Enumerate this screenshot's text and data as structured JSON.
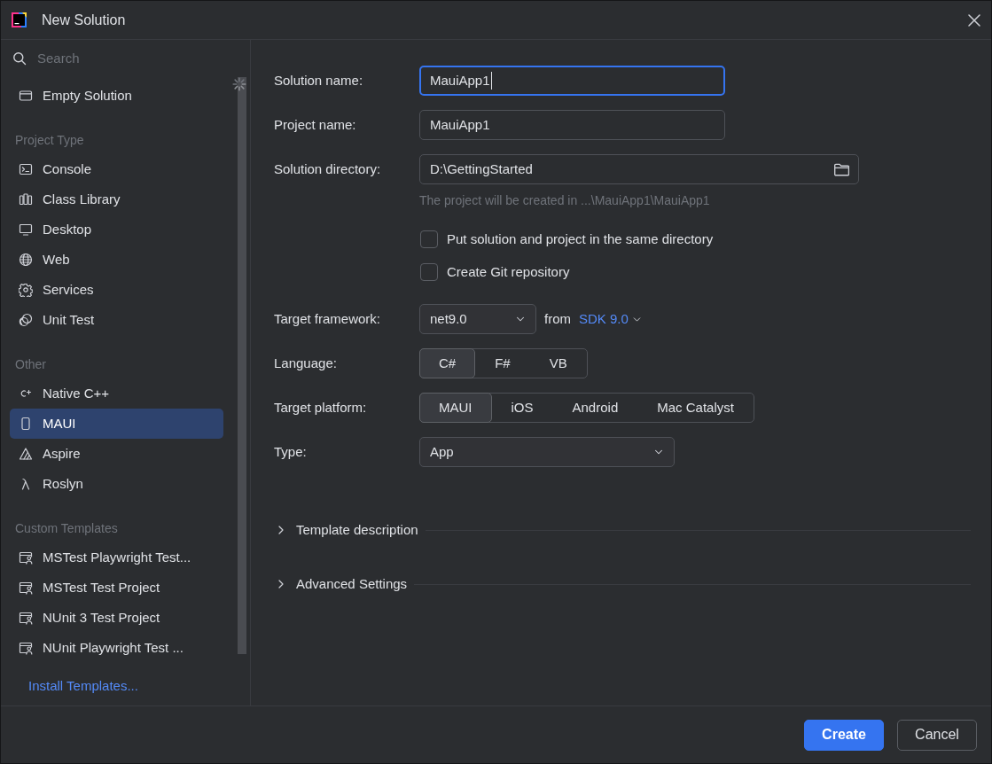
{
  "window": {
    "title": "New Solution"
  },
  "sidebar": {
    "search": {
      "placeholder": "Search"
    },
    "top_items": [
      {
        "label": "Empty Solution",
        "selected": false
      }
    ],
    "sections": [
      {
        "heading": "Project Type",
        "items": [
          {
            "label": "Console",
            "selected": false
          },
          {
            "label": "Class Library",
            "selected": false
          },
          {
            "label": "Desktop",
            "selected": false
          },
          {
            "label": "Web",
            "selected": false
          },
          {
            "label": "Services",
            "selected": false
          },
          {
            "label": "Unit Test",
            "selected": false
          }
        ]
      },
      {
        "heading": "Other",
        "items": [
          {
            "label": "Native C++",
            "selected": false
          },
          {
            "label": "MAUI",
            "selected": true
          },
          {
            "label": "Aspire",
            "selected": false
          },
          {
            "label": "Roslyn",
            "selected": false
          }
        ]
      },
      {
        "heading": "Custom Templates",
        "items": [
          {
            "label": "MSTest Playwright Test...",
            "selected": false
          },
          {
            "label": "MSTest Test Project",
            "selected": false
          },
          {
            "label": "NUnit 3 Test Project",
            "selected": false
          },
          {
            "label": "NUnit Playwright Test ...",
            "selected": false
          }
        ]
      }
    ],
    "install_link": "Install Templates..."
  },
  "form": {
    "fields": [
      {
        "kind": "text",
        "label": "Solution name:",
        "value": "MauiApp1",
        "focused": true
      },
      {
        "kind": "text",
        "label": "Project name:",
        "value": "MauiApp1",
        "focused": false
      },
      {
        "kind": "path",
        "label": "Solution directory:",
        "value": "D:\\GettingStarted",
        "focused": false,
        "hint": "The project will be created in ...\\MauiApp1\\MauiApp1"
      }
    ],
    "checkboxes": [
      {
        "label": "Put solution and project in the same directory",
        "checked": false
      },
      {
        "label": "Create Git repository",
        "checked": false
      }
    ],
    "options": [
      {
        "kind": "dropdown",
        "label": "Target framework:",
        "value": "net9.0",
        "suffix": "from",
        "link": "SDK 9.0"
      },
      {
        "kind": "segmented",
        "label": "Language:",
        "choices": [
          {
            "label": "C#",
            "selected": true
          },
          {
            "label": "F#",
            "selected": false
          },
          {
            "label": "VB",
            "selected": false
          }
        ]
      },
      {
        "kind": "segmented",
        "label": "Target platform:",
        "choices": [
          {
            "label": "MAUI",
            "selected": true
          },
          {
            "label": "iOS",
            "selected": false
          },
          {
            "label": "Android",
            "selected": false
          },
          {
            "label": "Mac Catalyst",
            "selected": false
          }
        ]
      },
      {
        "kind": "dropdown",
        "label": "Type:",
        "value": "App"
      }
    ]
  },
  "sections": [
    {
      "title": "Template description",
      "expanded": false
    },
    {
      "title": "Advanced Settings",
      "expanded": false
    }
  ],
  "buttons": [
    {
      "label": "Create",
      "kind": "primary"
    },
    {
      "label": "Cancel",
      "kind": "secondary"
    }
  ]
}
